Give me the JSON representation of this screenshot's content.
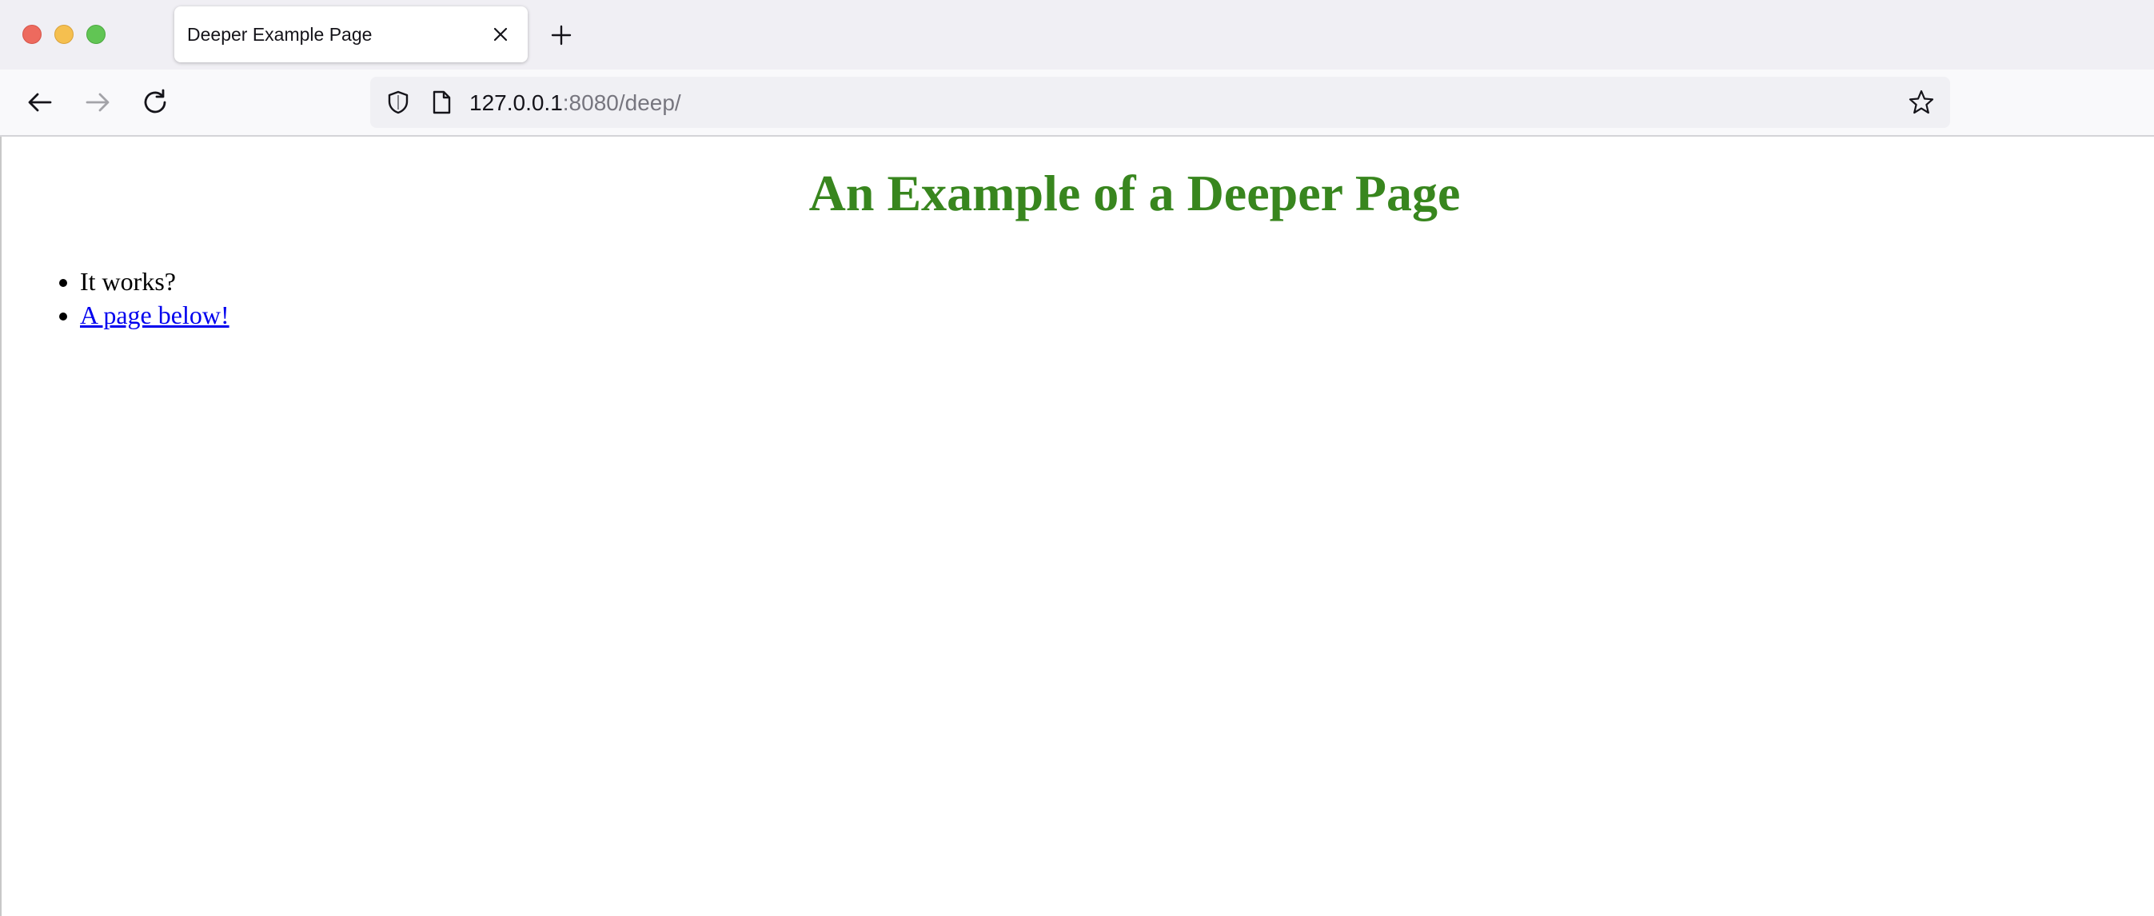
{
  "browser": {
    "tab": {
      "title": "Deeper Example Page"
    },
    "urlbar": {
      "host": "127.0.0.1",
      "rest": ":8080/deep/"
    }
  },
  "page": {
    "heading": "An Example of a Deeper Page",
    "items": [
      {
        "text": "It works?"
      },
      {
        "text": "A page below!"
      }
    ]
  },
  "colors": {
    "heading": "#38861e",
    "link": "#0000ee"
  },
  "icons": {
    "back": "back-arrow-icon",
    "forward": "forward-arrow-icon",
    "reload": "reload-icon",
    "shield": "shield-icon",
    "page": "page-icon",
    "star": "star-icon",
    "close": "close-icon",
    "new_tab": "plus-icon"
  }
}
